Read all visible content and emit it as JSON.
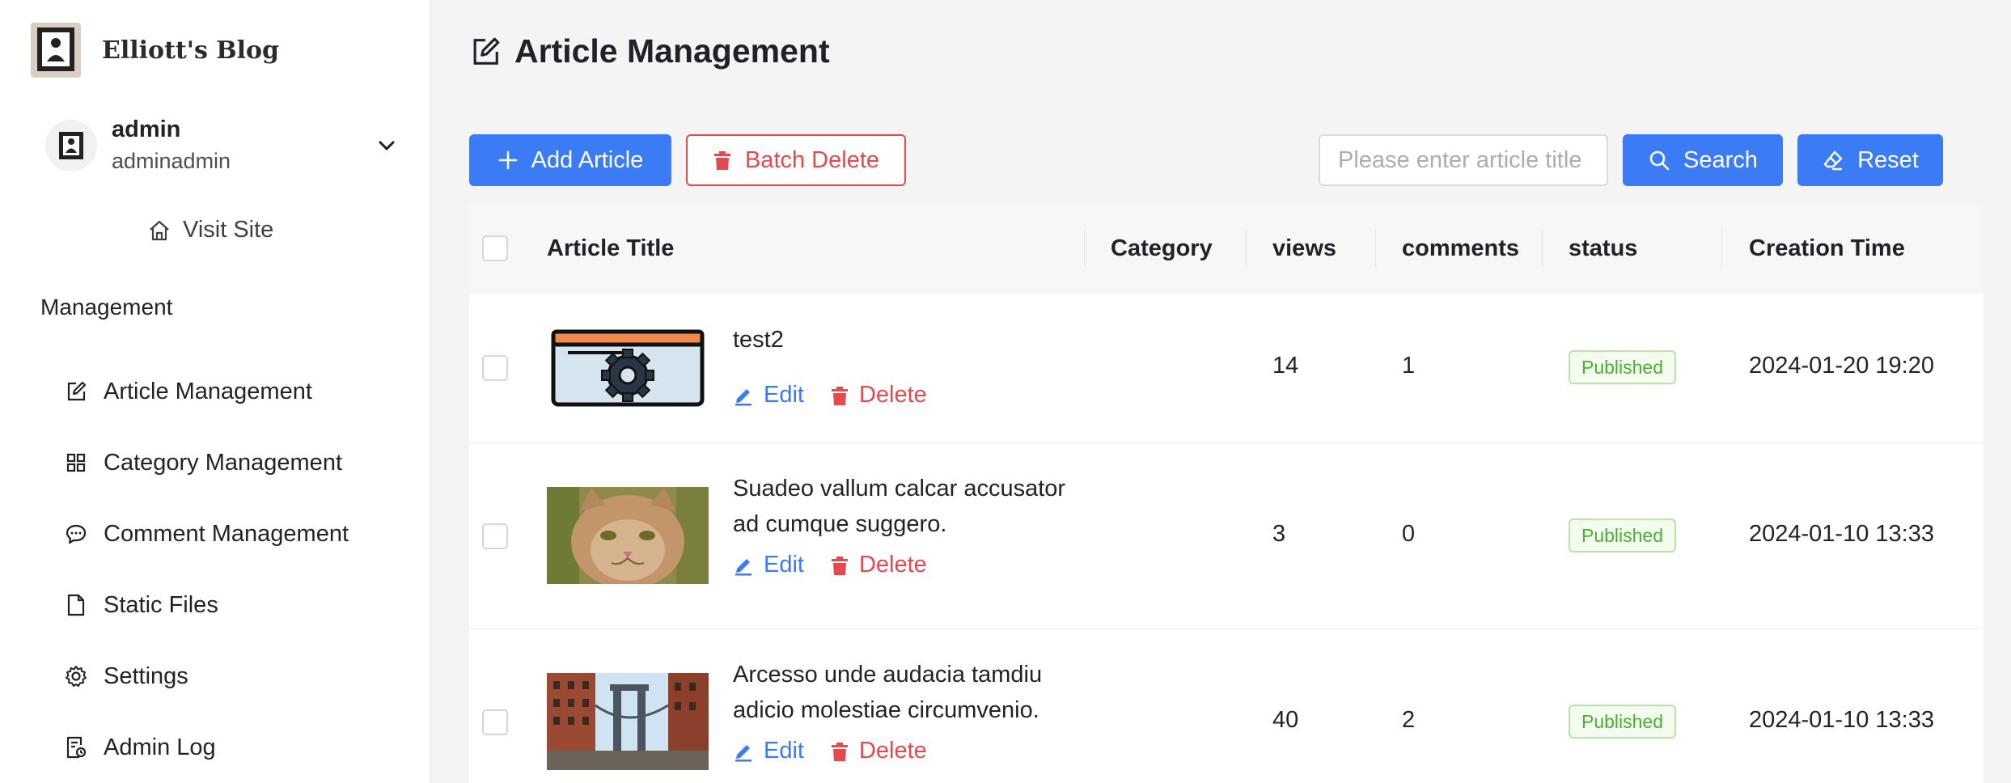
{
  "brand": {
    "name": "Elliott's Blog"
  },
  "user": {
    "name": "admin",
    "username": "adminadmin"
  },
  "visit_site": "Visit Site",
  "menu_section": "Management",
  "menu": [
    {
      "label": "Article Management",
      "icon": "edit-icon"
    },
    {
      "label": "Category Management",
      "icon": "grid-icon"
    },
    {
      "label": "Comment Management",
      "icon": "comment-icon"
    },
    {
      "label": "Static Files",
      "icon": "file-icon"
    },
    {
      "label": "Settings",
      "icon": "gear-icon"
    },
    {
      "label": "Admin Log",
      "icon": "log-icon"
    }
  ],
  "page_title": "Article Management",
  "toolbar": {
    "add_label": "Add Article",
    "batch_delete_label": "Batch Delete",
    "search_placeholder": "Please enter article title",
    "search_value": "",
    "search_label": "Search",
    "reset_label": "Reset"
  },
  "table": {
    "columns": [
      "Article Title",
      "Category",
      "views",
      "comments",
      "status",
      "Creation Time"
    ],
    "rows": [
      {
        "title": "test2",
        "category": "",
        "views": "14",
        "comments": "1",
        "status": "Published",
        "created": "2024-01-20 19:20",
        "edit": "Edit",
        "delete": "Delete",
        "thumb": "settings-window-illustration"
      },
      {
        "title": "Suadeo vallum calcar accusator ad cumque suggero.",
        "category": "",
        "views": "3",
        "comments": "0",
        "status": "Published",
        "created": "2024-01-10 13:33",
        "edit": "Edit",
        "delete": "Delete",
        "thumb": "cat-photo"
      },
      {
        "title": "Arcesso unde audacia tamdiu adicio molestiae circumvenio.",
        "category": "",
        "views": "40",
        "comments": "2",
        "status": "Published",
        "created": "2024-01-10 13:33",
        "edit": "Edit",
        "delete": "Delete",
        "thumb": "bridge-photo"
      }
    ]
  },
  "colors": {
    "primary": "#3b7bf5",
    "danger": "#e5484d",
    "success": "#4caf34"
  }
}
